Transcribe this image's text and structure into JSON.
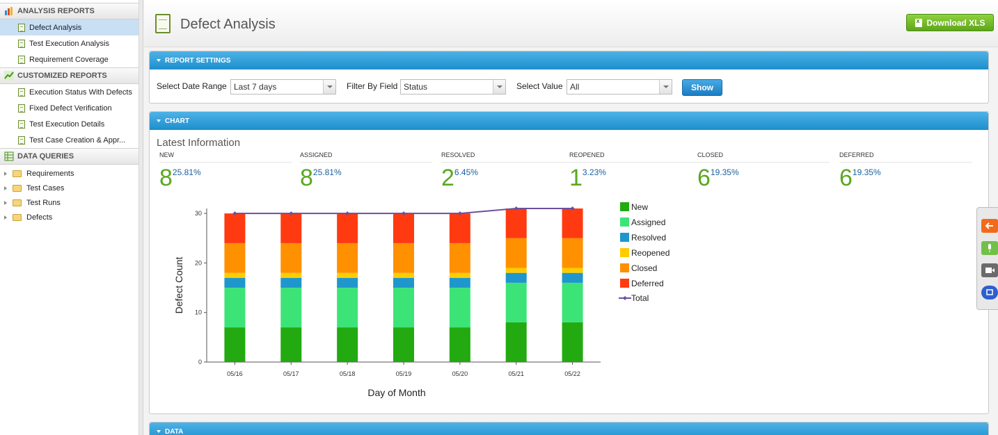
{
  "sidebar": {
    "analysis_reports": {
      "title": "ANALYSIS REPORTS",
      "items": [
        "Defect Analysis",
        "Test Execution Analysis",
        "Requirement Coverage"
      ]
    },
    "customized_reports": {
      "title": "CUSTOMIZED REPORTS",
      "items": [
        "Execution Status With Defects",
        "Fixed Defect Verification",
        "Test Execution Details",
        "Test Case Creation & Appr..."
      ]
    },
    "data_queries": {
      "title": "DATA QUERIES",
      "items": [
        "Requirements",
        "Test Cases",
        "Test Runs",
        "Defects"
      ]
    }
  },
  "header": {
    "title": "Defect Analysis",
    "download_label": "Download XLS"
  },
  "settings": {
    "panel_title": "REPORT SETTINGS",
    "date_range_label": "Select Date Range",
    "date_range_value": "Last 7 days",
    "filter_label": "Filter By Field",
    "filter_value": "Status",
    "value_label": "Select Value",
    "value_value": "All",
    "show_label": "Show"
  },
  "chart_panel": {
    "panel_title": "CHART",
    "latest_title": "Latest Information",
    "stats": [
      {
        "label": "NEW",
        "count": "8",
        "pct": "25.81%"
      },
      {
        "label": "ASSIGNED",
        "count": "8",
        "pct": "25.81%"
      },
      {
        "label": "RESOLVED",
        "count": "2",
        "pct": "6.45%"
      },
      {
        "label": "REOPENED",
        "count": "1",
        "pct": "3.23%"
      },
      {
        "label": "CLOSED",
        "count": "6",
        "pct": "19.35%"
      },
      {
        "label": "DEFERRED",
        "count": "6",
        "pct": "19.35%"
      }
    ]
  },
  "data_panel": {
    "panel_title": "DATA"
  },
  "colors": {
    "New": "#22aa10",
    "Assigned": "#3ce478",
    "Resolved": "#1f97cc",
    "Reopened": "#ffcc00",
    "Closed": "#ff9000",
    "Deferred": "#ff3a10",
    "Total": "#6d4f9c"
  },
  "chart_data": {
    "type": "bar",
    "stacked": true,
    "categories": [
      "05/16",
      "05/17",
      "05/18",
      "05/19",
      "05/20",
      "05/21",
      "05/22"
    ],
    "series": [
      {
        "name": "New",
        "values": [
          7,
          7,
          7,
          7,
          7,
          8,
          8
        ]
      },
      {
        "name": "Assigned",
        "values": [
          8,
          8,
          8,
          8,
          8,
          8,
          8
        ]
      },
      {
        "name": "Resolved",
        "values": [
          2,
          2,
          2,
          2,
          2,
          2,
          2
        ]
      },
      {
        "name": "Reopened",
        "values": [
          1,
          1,
          1,
          1,
          1,
          1,
          1
        ]
      },
      {
        "name": "Closed",
        "values": [
          6,
          6,
          6,
          6,
          6,
          6,
          6
        ]
      },
      {
        "name": "Deferred",
        "values": [
          6,
          6,
          6,
          6,
          6,
          6,
          6
        ]
      }
    ],
    "line_series": {
      "name": "Total",
      "values": [
        30,
        30,
        30,
        30,
        30,
        31,
        31
      ]
    },
    "xlabel": "Day of Month",
    "ylabel": "Defect Count",
    "ylim": [
      0,
      30
    ],
    "yticks": [
      0,
      10,
      20,
      30
    ],
    "legend_position": "right"
  }
}
